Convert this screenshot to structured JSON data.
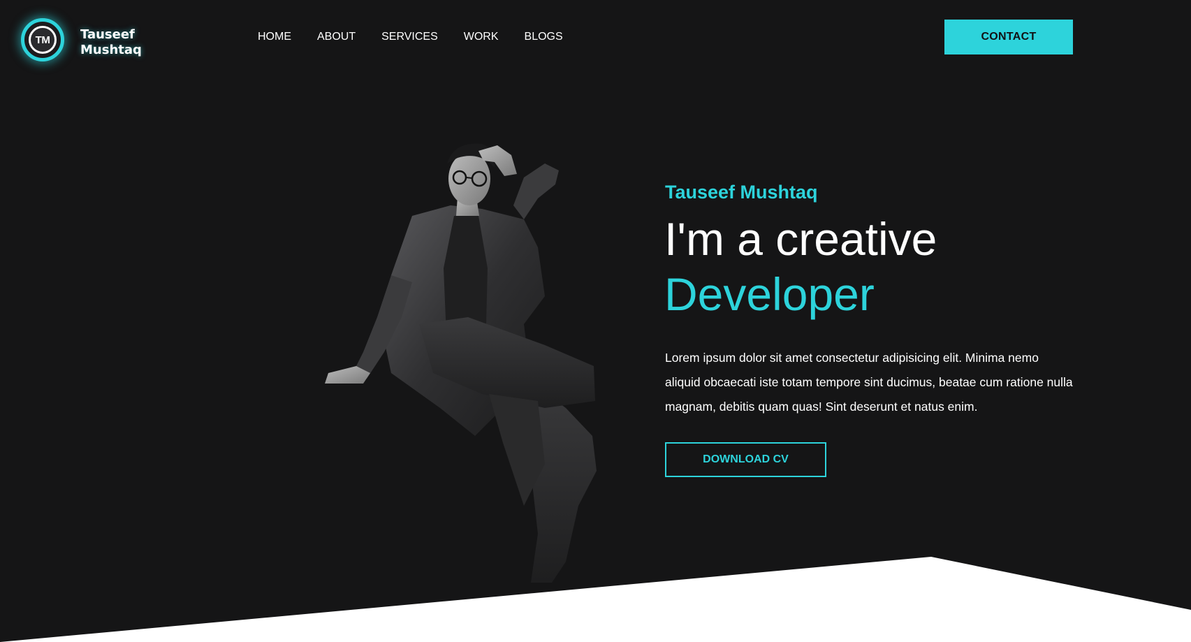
{
  "header": {
    "logo": {
      "monogram": "TM",
      "line1": "Tauseef",
      "line2": "Mushtaq"
    },
    "nav": [
      {
        "label": "HOME"
      },
      {
        "label": "ABOUT"
      },
      {
        "label": "SERVICES"
      },
      {
        "label": "WORK"
      },
      {
        "label": "BLOGS"
      }
    ],
    "contact_label": "CONTACT"
  },
  "hero": {
    "name": "Tauseef Mushtaq",
    "title_line1": "I'm a creative",
    "title_line2": "Developer",
    "description": "Lorem ipsum dolor sit amet consectetur adipisicing elit. Minima nemo aliquid obcaecati iste totam tempore sint ducimus, beatae cum ratione nulla magnam, debitis quam quas! Sint deserunt et natus enim.",
    "cta_label": "DOWNLOAD CV",
    "photo": "portrait-photo"
  },
  "colors": {
    "background": "#151516",
    "accent": "#2dd3db",
    "text": "#ffffff",
    "bottom_shape": "#ffffff"
  }
}
